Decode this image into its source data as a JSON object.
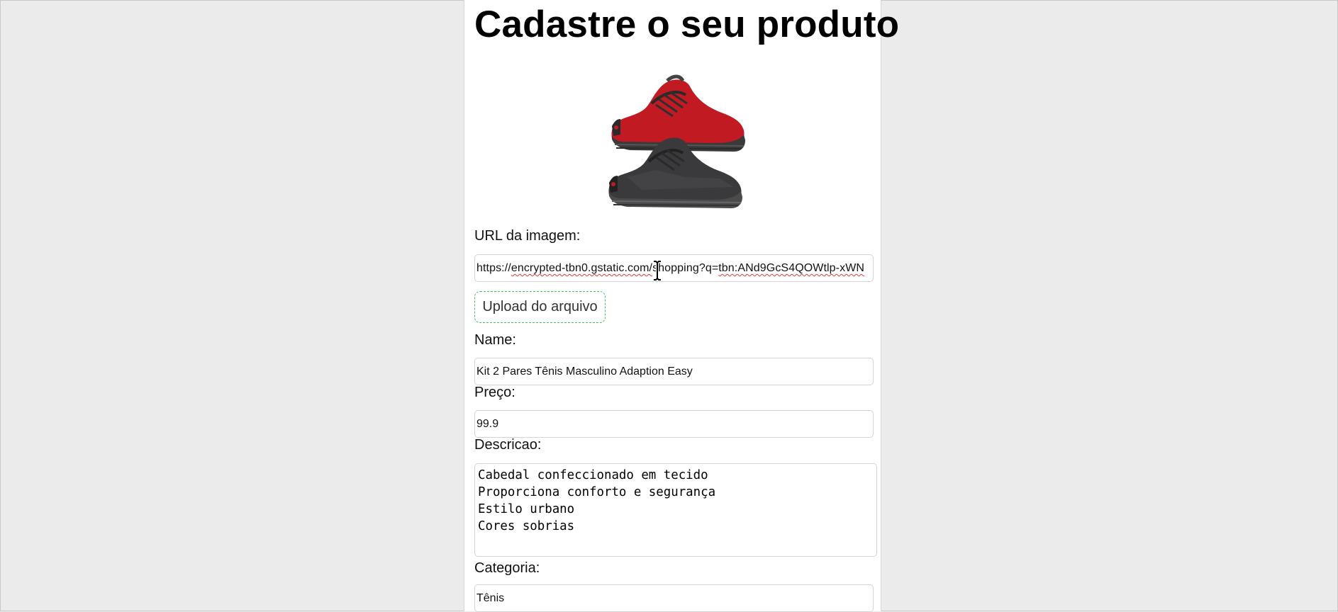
{
  "form": {
    "title": "Cadastre o seu produto",
    "image_alt": "red-and-black-sneakers-image",
    "url_label": "URL da imagem:",
    "url_value": {
      "part1": "https://",
      "part2": "encrypted-tbn0.gstatic.com/",
      "part3": "shopping?q=",
      "part4": "tbn:ANd9GcS4QOWtlp-xWN"
    },
    "upload_label": "Upload do arquivo",
    "name_label": "Name:",
    "name_value": "Kit 2 Pares Tênis Masculino Adaption Easy",
    "price_label": "Preço:",
    "price_value": "99.9",
    "description_label": "Descricao:",
    "description_lines": [
      "Cabedal confeccionado em tecido",
      "Proporciona conforto e segurança",
      "Estilo urbano",
      "Cores sobrias"
    ],
    "category_label": "Categoria:",
    "category_value": "Tênis"
  },
  "colors": {
    "page_background": "#ebebeb",
    "panel_background": "#ffffff",
    "upload_border": "#3cc35c",
    "spellcheck_underline": "#e2393a"
  }
}
